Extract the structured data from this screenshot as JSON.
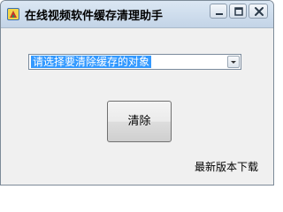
{
  "window": {
    "title": "在线视频软件缓存清理助手",
    "icon": "app-broom-icon"
  },
  "title_buttons": {
    "minimize_icon": "minimize-icon",
    "maximize_icon": "maximize-icon",
    "close_icon": "close-icon"
  },
  "combo": {
    "selected_value": "请选择要清除缓存的对象",
    "arrow_icon": "chevron-down-icon"
  },
  "clear_button": {
    "label": "清除"
  },
  "footer": {
    "download_link": "最新版本下载"
  },
  "colors": {
    "selection_highlight": "#3399ff",
    "titlebar_top": "#dbe7f3",
    "client_background": "#f0f0f0"
  }
}
